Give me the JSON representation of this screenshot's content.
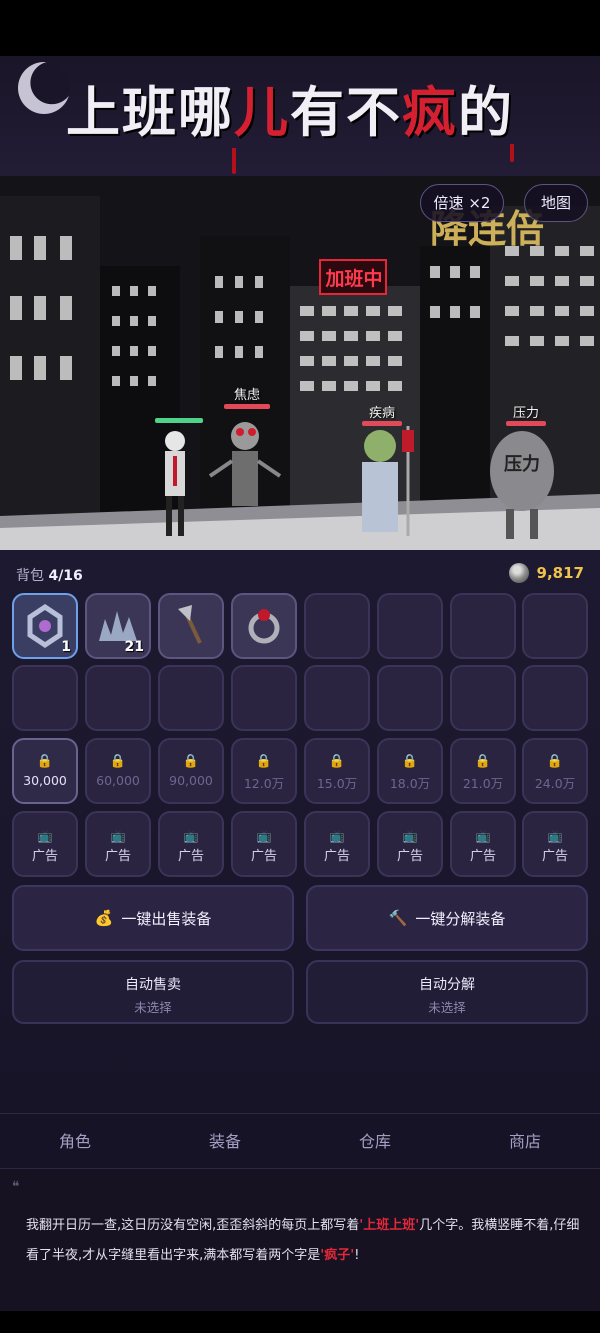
{
  "header": {
    "title_part1": "上班哪",
    "title_red": "儿",
    "title_part2": "有不",
    "title_red2": "疯",
    "title_part3": "的"
  },
  "scene": {
    "speed_button": "倍速 ×2",
    "map_button": "地图",
    "neon_sign": "加班中",
    "banner_text": "降连倍",
    "enemies": [
      {
        "name": "",
        "hp": 1.0,
        "hp_color": "#4fd38a"
      },
      {
        "name": "焦虑",
        "hp": 1.0,
        "hp_color": "#e24a5a"
      },
      {
        "name": "疾病",
        "hp": 1.0,
        "hp_color": "#e24a5a"
      },
      {
        "name": "压力",
        "hp": 1.0,
        "hp_color": "#e24a5a"
      }
    ],
    "stone_label": "压力"
  },
  "inventory": {
    "bag_label": "背包",
    "bag_count": "4/16",
    "gold": "9,817",
    "items": [
      {
        "icon": "crystal-ring-icon",
        "qty": "1"
      },
      {
        "icon": "ore-cluster-icon",
        "qty": "21"
      },
      {
        "icon": "axe-icon",
        "qty": ""
      },
      {
        "icon": "ruby-ring-icon",
        "qty": ""
      }
    ],
    "lock_prices": [
      "30,000",
      "60,000",
      "90,000",
      "12.0万",
      "15.0万",
      "18.0万",
      "21.0万",
      "24.0万"
    ],
    "ad_label": "广告",
    "sell_all": "一键出售装备",
    "dismantle_all": "一键分解装备",
    "auto_sell": "自动售卖",
    "auto_sell_value": "未选择",
    "auto_dismantle": "自动分解",
    "auto_dismantle_value": "未选择"
  },
  "tabs": [
    "角色",
    "装备",
    "仓库",
    "商店"
  ],
  "story": {
    "p1": "我翻开日历一查,这日历没有空闲,歪歪斜斜的每页上都写着",
    "h1": "'上班上班'",
    "p2": "几个字。我横竖睡不着,仔细看了半夜,才从字缝里看出字来,满本都写着两个字是",
    "h2": "'疯子'",
    "p3": "!"
  },
  "colors": {
    "accent_gold": "#f2c34b",
    "highlight_red": "#e2283a",
    "panel_bg": "#1d1930"
  }
}
